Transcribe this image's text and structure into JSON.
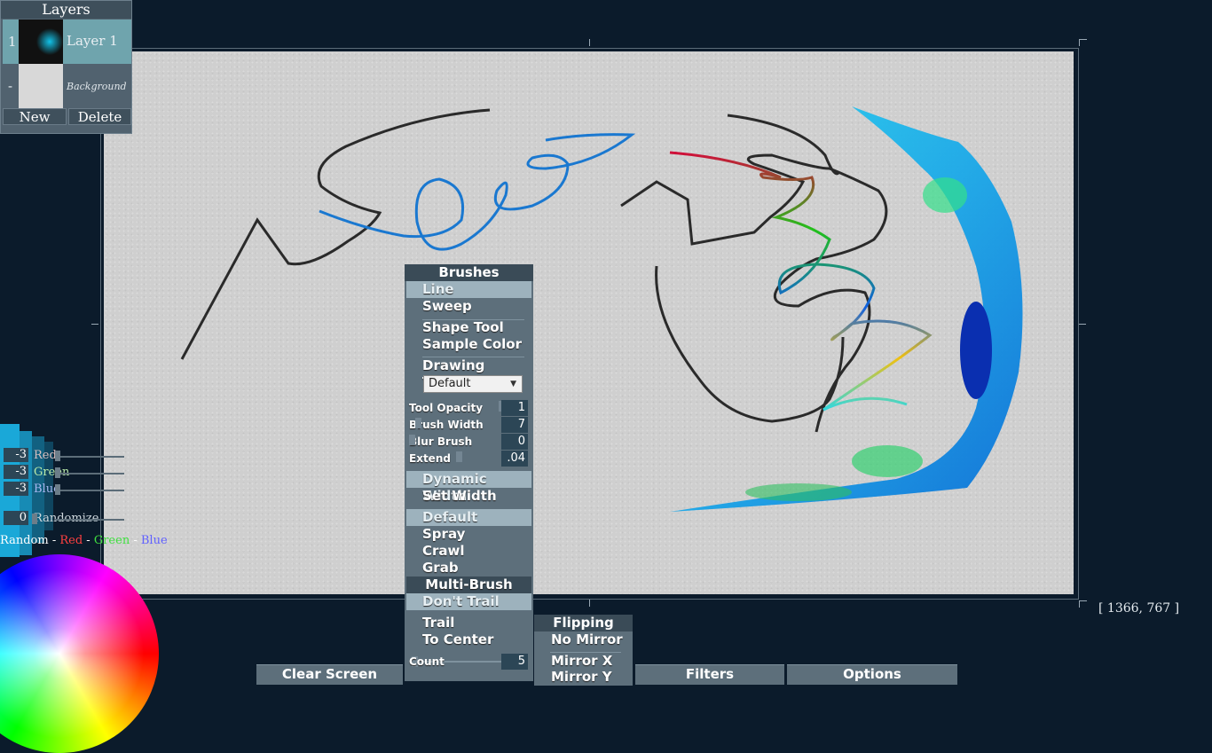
{
  "layers_panel": {
    "title": "Layers",
    "layers": [
      {
        "index": "1",
        "name": "Layer 1"
      },
      {
        "index": "-",
        "name": "Background"
      }
    ],
    "new_label": "New",
    "delete_label": "Delete"
  },
  "color_panel": {
    "red": {
      "value": "-3",
      "label": "Red"
    },
    "green": {
      "value": "-3",
      "label": "Green"
    },
    "blue": {
      "value": "-3",
      "label": "Blue"
    },
    "randomize": {
      "value": "0",
      "label": "Randomize"
    },
    "random_line": {
      "prefix": "Random - ",
      "red": "Red",
      "sep1": " - ",
      "green": "Green",
      "sep2": " - ",
      "blue": "Blue"
    }
  },
  "brushes_panel": {
    "title": "Brushes",
    "line": "Line",
    "sweep": "Sweep",
    "shape_tool": "Shape Tool",
    "sample_color": "Sample Color",
    "drawing_tools_label": "Drawing Tools:",
    "drawing_tools_value": "Default",
    "tool_opacity": {
      "label": "Tool Opacity",
      "value": "1"
    },
    "brush_width": {
      "label": "Brush Width",
      "value": "7"
    },
    "blur_brush": {
      "label": "Blur Brush",
      "value": "0"
    },
    "extend": {
      "label": "Extend",
      "value": ".04"
    },
    "dynamic_width": "Dynamic Width",
    "set_width": "Set Width",
    "default": "Default",
    "spray": "Spray",
    "crawl": "Crawl",
    "grab": "Grab",
    "multi_brush": "Multi-Brush",
    "dont_trail": "Don't Trail",
    "trail": "Trail",
    "to_center": "To Center",
    "count": {
      "label": "Count",
      "value": "5"
    }
  },
  "flipping_panel": {
    "title": "Flipping",
    "no_mirror": "No Mirror",
    "mirror_x": "Mirror X",
    "mirror_y": "Mirror Y"
  },
  "bottom_tabs": {
    "clear_screen": "Clear Screen",
    "filters": "Filters",
    "options": "Options"
  },
  "coordinates": "[ 1366, 767 ]",
  "colors": {
    "background": "#0b1b2b",
    "panel": "#5d6f7b",
    "panel_header": "#3a4b57",
    "highlight": "#9db2bd",
    "canvas": "#cfcfcf"
  }
}
